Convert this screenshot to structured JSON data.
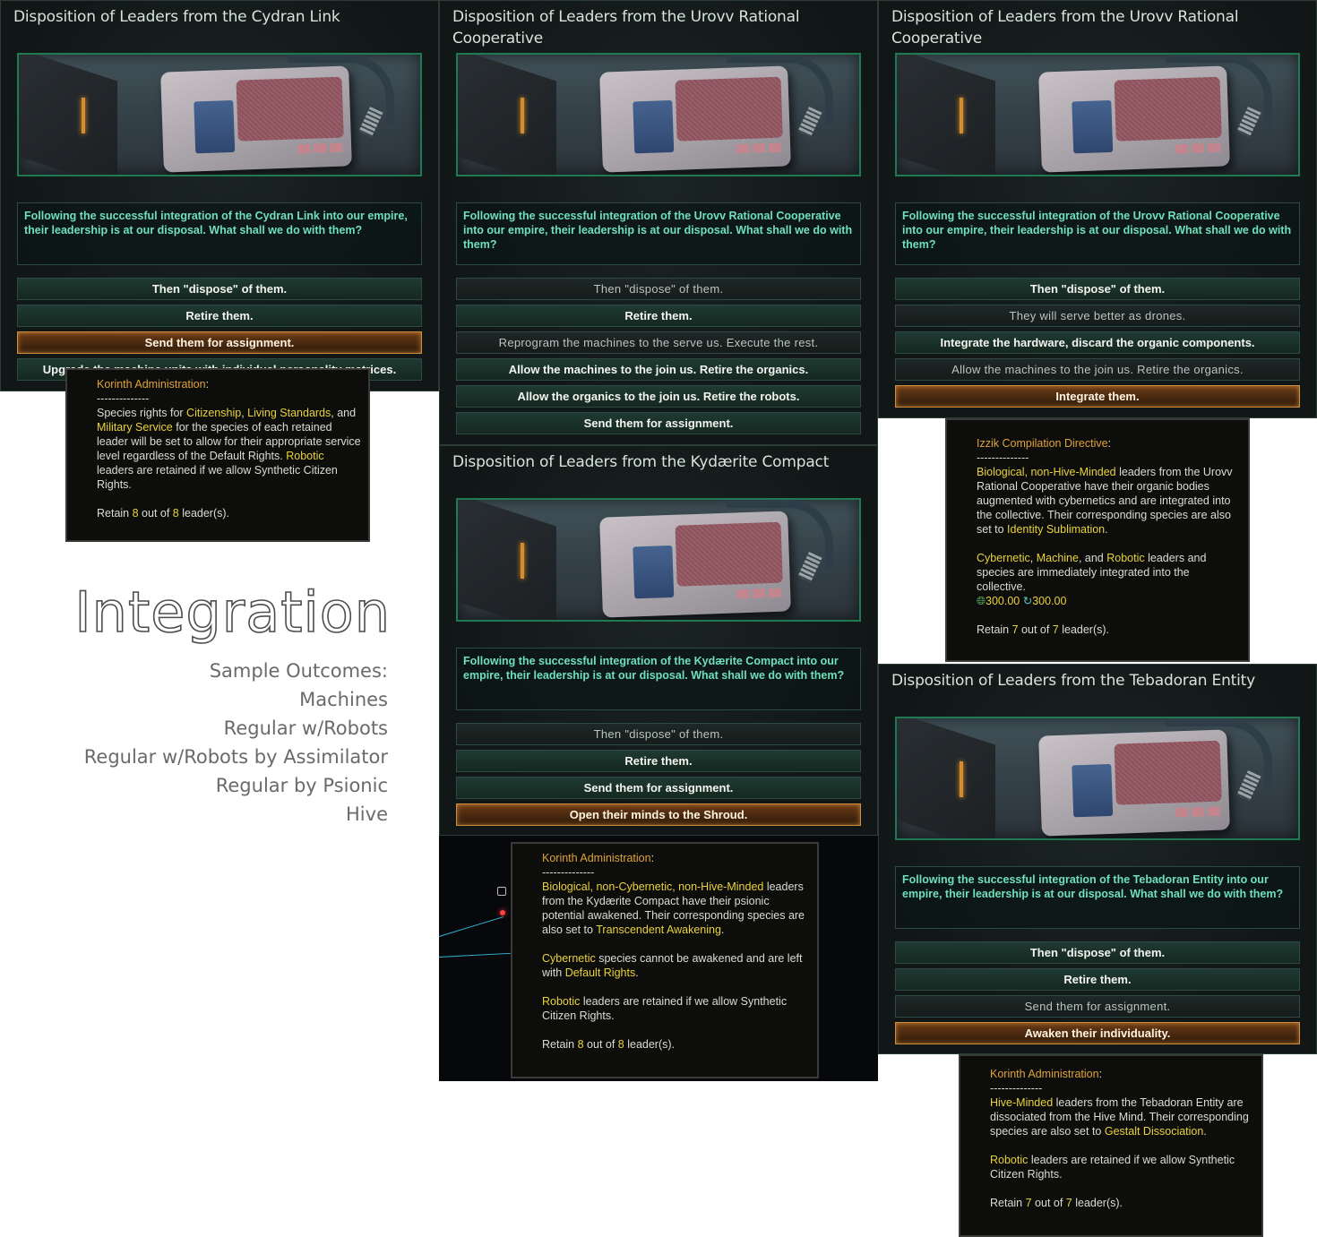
{
  "heading": "Integration",
  "outcomes": [
    "Sample Outcomes:",
    "Machines",
    "Regular w/Robots",
    "Regular w/Robots by Assimilator",
    "Regular by Psionic",
    "Hive"
  ],
  "panels": [
    {
      "title": "Disposition of Leaders from the Cydran Link",
      "question": "Following the successful integration of the Cydran Link into our empire, their leadership is at our disposal. What shall we do with them?",
      "options": [
        "Then \"dispose\" of them.",
        "Retire them.",
        "Send them for assignment.",
        "Upgrade the machine units with individual personality matrices."
      ]
    },
    {
      "title": "Disposition of Leaders from the Urovv Rational Cooperative",
      "question": "Following the successful integration of the Urovv Rational Cooperative into our empire, their leadership is at our disposal. What shall we do with them?",
      "options": [
        "Then \"dispose\" of them.",
        "Retire them.",
        "Reprogram the machines to the serve us. Execute the rest.",
        "Allow the machines to the join us. Retire the organics.",
        "Allow the organics to the join us. Retire the robots.",
        "Send them for assignment."
      ]
    },
    {
      "title": "Disposition of Leaders from the Urovv Rational Cooperative",
      "question": "Following the successful integration of the Urovv Rational Cooperative into our empire, their leadership is at our disposal. What shall we do with them?",
      "options": [
        "Then \"dispose\" of them.",
        "They will serve better as drones.",
        "Integrate the hardware, discard the organic components.",
        "Allow the machines to the join us. Retire the organics.",
        "Integrate them."
      ]
    },
    {
      "title": "Disposition of Leaders from the Kydærite Compact",
      "question": "Following the successful integration of the Kydærite Compact into our empire, their leadership is at our disposal. What shall we do with them?",
      "options": [
        "Then \"dispose\" of them.",
        "Retire them.",
        "Send them for assignment.",
        "Open their minds to the Shroud."
      ]
    },
    {
      "title": "Disposition of Leaders from the Tebadoran Entity",
      "question": "Following the successful integration of the Tebadoran Entity into our empire, their leadership is at our disposal. What shall we do with them?",
      "options": [
        "Then \"dispose\" of them.",
        "Retire them.",
        "Send them for assignment.",
        "Awaken their individuality."
      ]
    }
  ],
  "tooltips": {
    "cydran": {
      "header": "Korinth Administration",
      "sep": "--------------",
      "t1": "Species rights for ",
      "k1": "Citizenship",
      "t2": ", ",
      "k2": "Living Standards",
      "t3": ", and ",
      "k3": "Military Service",
      "t4": " for the species of each retained leader will be set to allow for their appropriate service level regardless of the Default Rights. ",
      "k4": "Robotic",
      "t5": " leaders are retained if we allow Synthetic Citizen Rights.",
      "retain_a": "Retain ",
      "retain_n1": "8",
      "retain_b": " out of ",
      "retain_n2": "8",
      "retain_c": " leader(s)."
    },
    "urovv": {
      "header": "Izzik Compilation Directive",
      "sep": "--------------",
      "k1": "Biological, non-Hive-Minded",
      "t1": " leaders from the Urovv Rational Cooperative have their organic bodies augmented with cybernetics and are integrated into the collective. Their corresponding species are also set to ",
      "k2": "Identity Sublimation",
      "t2": ".",
      "k3": "Cybernetic",
      "t3": ", ",
      "k4": "Machine",
      "t4": ", and ",
      "k5": "Robotic",
      "t5": " leaders and species are immediately integrated into the collective.",
      "res1": "300.00",
      "res2": "300.00",
      "retain_a": "Retain ",
      "retain_n1": "7",
      "retain_b": " out of ",
      "retain_n2": "7",
      "retain_c": " leader(s)."
    },
    "kydaerite": {
      "header": "Korinth Administration",
      "sep": "--------------",
      "k1": "Biological, non-Cybernetic, non-Hive-Minded",
      "t1": " leaders from the Kydærite Compact have their psionic potential awakened. Their corresponding species are also set to ",
      "k2": "Transcendent Awakening",
      "t2": ".",
      "k3": "Cybernetic",
      "t3": " species cannot be awakened and are left with ",
      "k4": "Default Rights",
      "t4": ".",
      "k5": "Robotic",
      "t5": " leaders are retained if we allow Synthetic Citizen Rights.",
      "retain_a": "Retain ",
      "retain_n1": "8",
      "retain_b": " out of ",
      "retain_n2": "8",
      "retain_c": " leader(s)."
    },
    "tebadoran": {
      "header": "Korinth Administration",
      "sep": "--------------",
      "k1": "Hive-Minded",
      "t1": " leaders from the Tebadoran Entity are dissociated from the Hive Mind. Their corresponding species are also set to ",
      "k2": "Gestalt Dissociation",
      "t2": ".",
      "k3": "Robotic",
      "t3": " leaders are retained if we allow Synthetic Citizen Rights.",
      "retain_a": "Retain ",
      "retain_n1": "7",
      "retain_b": " out of ",
      "retain_n2": "7",
      "retain_c": " leader(s)."
    }
  },
  "colors": {
    "question": "#6fe0bb",
    "keyword": "#e9d33a",
    "header": "#e0a33a",
    "selected_border": "#d08b3c"
  }
}
